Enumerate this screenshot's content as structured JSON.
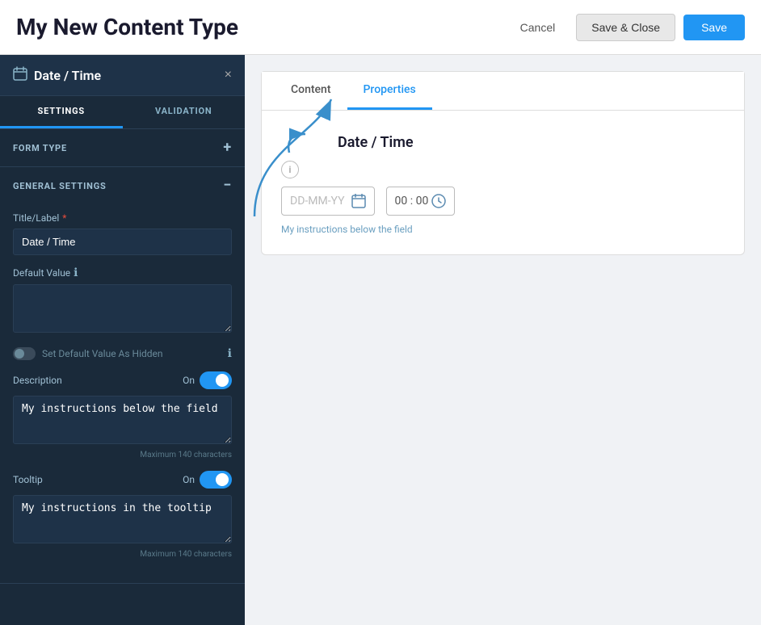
{
  "header": {
    "title": "My New Content Type",
    "cancel_label": "Cancel",
    "save_close_label": "Save & Close",
    "save_label": "Save"
  },
  "sidebar": {
    "widget_title": "Date / Time",
    "close_icon": "×",
    "tabs": [
      {
        "id": "settings",
        "label": "SETTINGS",
        "active": true
      },
      {
        "id": "validation",
        "label": "VALIDATION",
        "active": false
      }
    ],
    "sections": [
      {
        "id": "form-type",
        "label": "FORM TYPE",
        "collapsed": true,
        "icon": "+"
      },
      {
        "id": "general-settings",
        "label": "GENERAL SETTINGS",
        "collapsed": false,
        "icon": "−"
      }
    ],
    "fields": {
      "title_label": "Title/Label",
      "title_required": true,
      "title_value": "Date / Time",
      "default_value_label": "Default Value",
      "default_value": "",
      "set_hidden_label": "Set Default Value As Hidden",
      "description_label": "Description",
      "description_on_label": "On",
      "description_value": "My instructions below the field",
      "description_char_limit": "Maximum 140 characters",
      "tooltip_label": "Tooltip",
      "tooltip_on_label": "On",
      "tooltip_value": "My instructions in the tooltip",
      "tooltip_char_limit": "Maximum 140 characters"
    }
  },
  "content": {
    "tabs": [
      {
        "id": "content",
        "label": "Content",
        "active": false
      },
      {
        "id": "properties",
        "label": "Properties",
        "active": true
      }
    ],
    "preview": {
      "title": "Date / Time",
      "date_placeholder": "DD-MM-YY",
      "time_placeholder": "00 : 00",
      "hint": "My instructions below the field"
    }
  },
  "icons": {
    "calendar": "📅",
    "clock": "🕐",
    "info": "ℹ",
    "widget": "📅"
  }
}
